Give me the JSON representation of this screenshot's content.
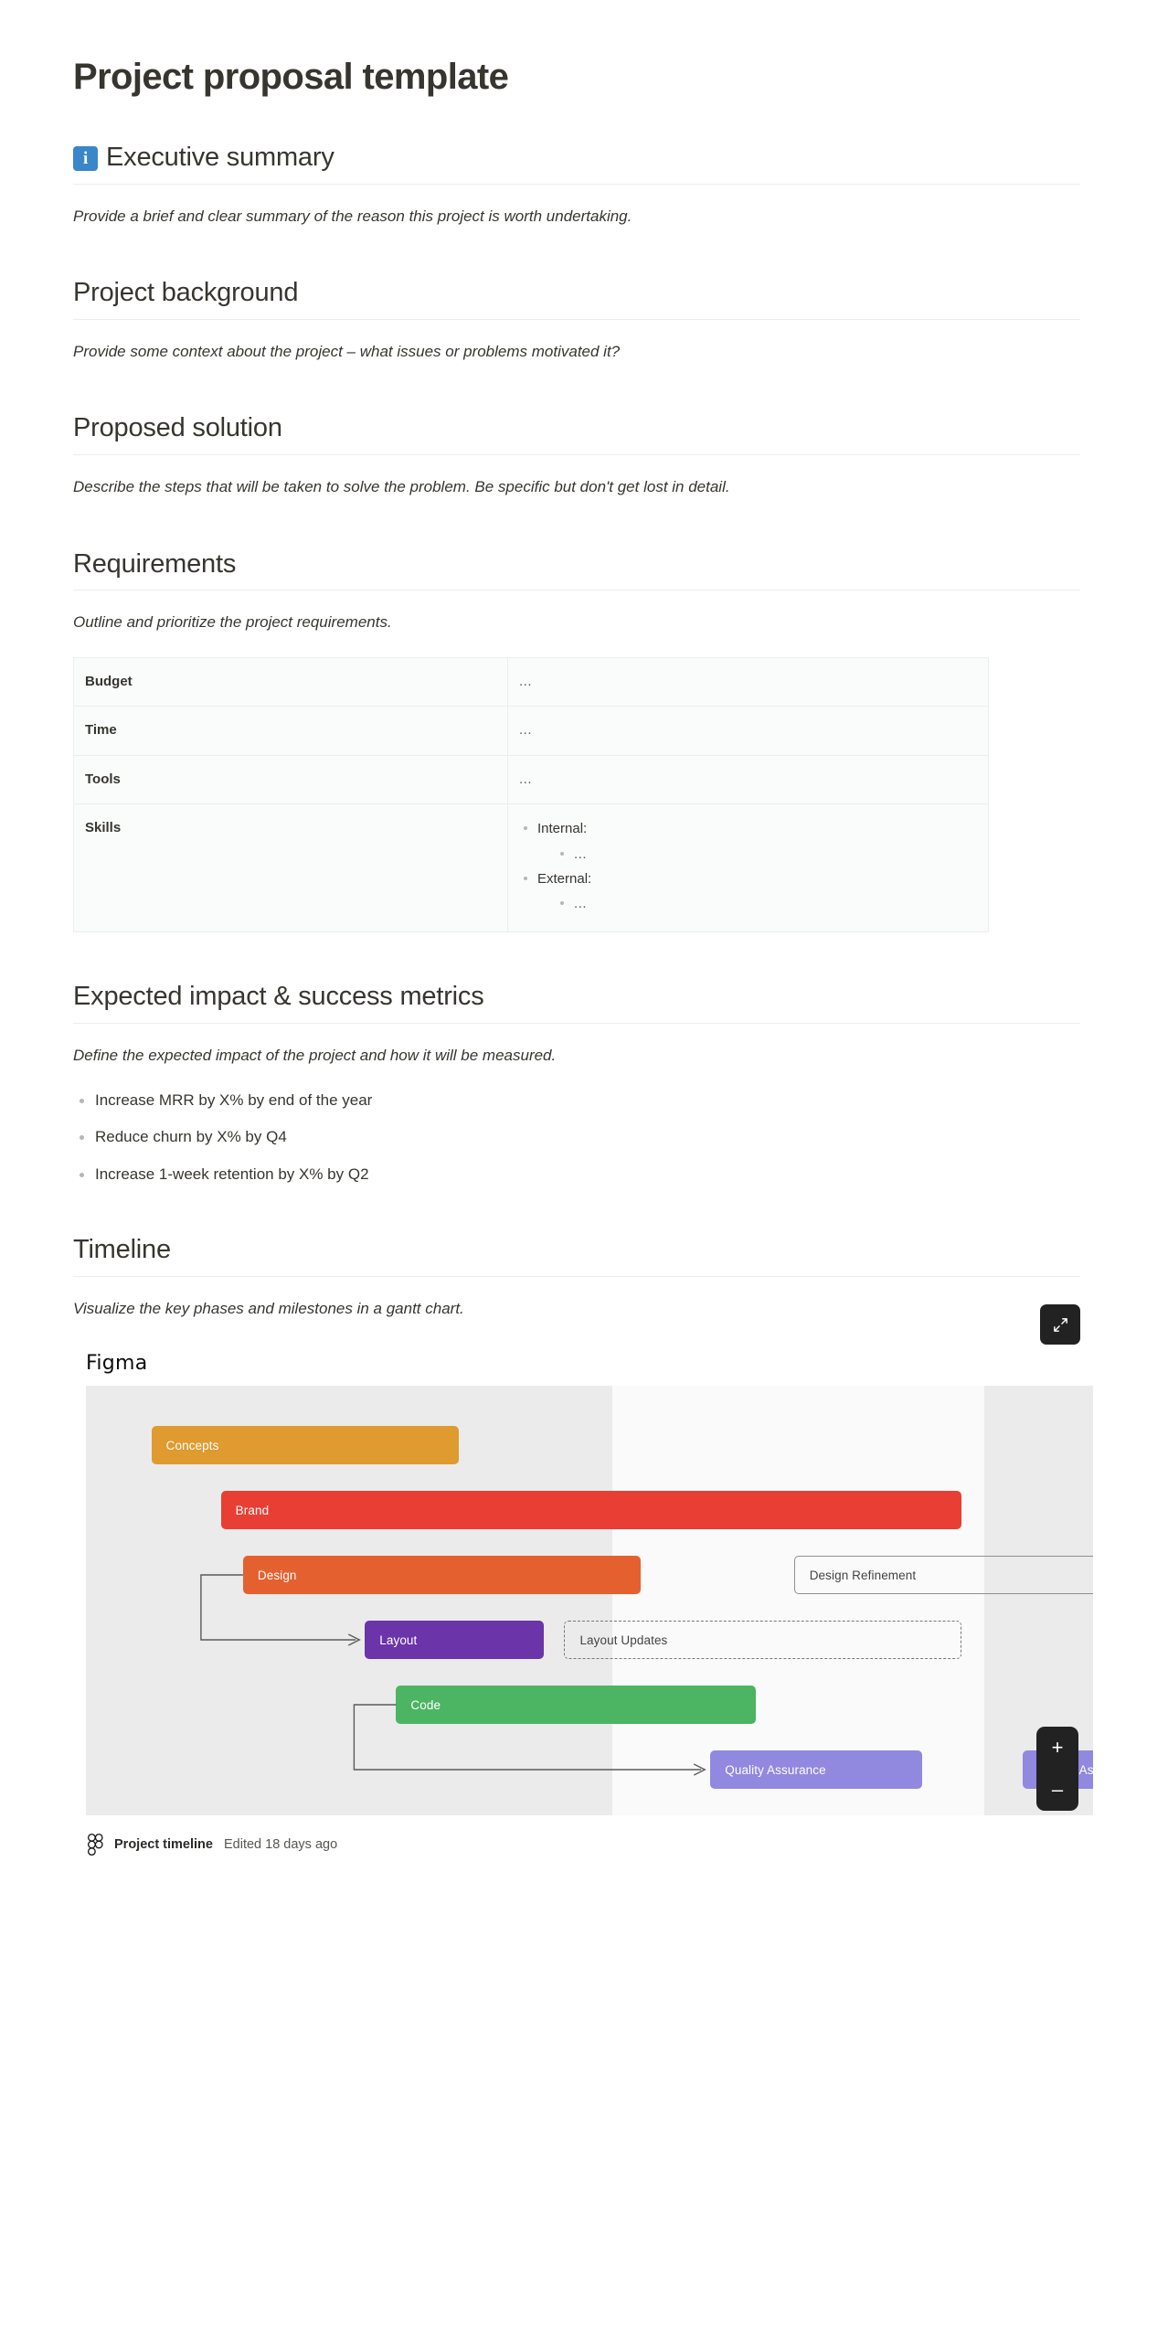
{
  "document": {
    "title": "Project proposal template"
  },
  "sections": {
    "executive_summary": {
      "icon": "info-icon",
      "icon_glyph": "i",
      "heading": "Executive summary",
      "body": "Provide a brief and clear summary of the reason this project is worth undertaking."
    },
    "project_background": {
      "heading": "Project background",
      "body": "Provide some context about the project – what issues or problems motivated it?"
    },
    "proposed_solution": {
      "heading": "Proposed solution",
      "body": "Describe the steps that will be taken to solve the problem. Be specific but don't get lost in detail."
    },
    "requirements": {
      "heading": "Requirements",
      "body": "Outline and prioritize the project requirements.",
      "rows": [
        {
          "key": "Budget",
          "value": "..."
        },
        {
          "key": "Time",
          "value": "..."
        },
        {
          "key": "Tools",
          "value": "..."
        }
      ],
      "skills_row": {
        "key": "Skills",
        "items": [
          {
            "label": "Internal:",
            "sub": "..."
          },
          {
            "label": "External:",
            "sub": "..."
          }
        ]
      }
    },
    "expected_impact": {
      "heading": "Expected impact & success metrics",
      "body": "Define the expected impact of the project and how it will be measured.",
      "bullets": [
        "Increase MRR by X% by end of the year",
        "Reduce churn by X% by Q4",
        "Increase 1-week retention by X% by Q2"
      ]
    },
    "timeline": {
      "heading": "Timeline",
      "body": "Visualize the key phases and milestones in a gantt chart.",
      "embed": {
        "provider": "Figma",
        "expand_label": "Expand",
        "zoom_in_label": "+",
        "zoom_out_label": "–",
        "footer": {
          "file_name": "Project timeline",
          "meta": "Edited 18 days ago"
        }
      }
    }
  },
  "chart_data": {
    "type": "bar",
    "title": "Project timeline",
    "xlabel": "",
    "ylabel": "",
    "orientation": "horizontal",
    "grid": false,
    "legend": "none",
    "bands": [
      {
        "start_pct": 0.0,
        "end_pct": 52.3,
        "color": "#ebebeb"
      },
      {
        "start_pct": 52.3,
        "end_pct": 89.2,
        "color": "#fafafa"
      },
      {
        "start_pct": 89.2,
        "end_pct": 100.0,
        "color": "#ebebeb"
      }
    ],
    "categories": [
      "Concepts",
      "Brand",
      "Design",
      "Design Refinement",
      "Layout",
      "Layout Updates",
      "Code",
      "Quality Assurance",
      "Quality Assurance"
    ],
    "tasks": [
      {
        "label": "Concepts",
        "row": 0,
        "start_pct": 6.5,
        "end_pct": 37.0,
        "color": "#df9a30",
        "style": "solid",
        "text_color": "#ffffff"
      },
      {
        "label": "Brand",
        "row": 1,
        "start_pct": 13.4,
        "end_pct": 86.9,
        "color": "#e83e33",
        "style": "solid",
        "text_color": "#ffffff"
      },
      {
        "label": "Design",
        "row": 2,
        "start_pct": 15.6,
        "end_pct": 55.1,
        "color": "#e5602f",
        "style": "solid",
        "text_color": "#ffffff"
      },
      {
        "label": "Design Refinement",
        "row": 2,
        "start_pct": 70.3,
        "end_pct": 107.9,
        "color": "#8f8f8f",
        "style": "outline",
        "text_color": "#444444"
      },
      {
        "label": "Layout",
        "row": 3,
        "start_pct": 27.7,
        "end_pct": 45.5,
        "color": "#6b34a8",
        "style": "solid",
        "text_color": "#ffffff"
      },
      {
        "label": "Layout Updates",
        "row": 3,
        "start_pct": 47.5,
        "end_pct": 86.9,
        "color": "#777777",
        "style": "dashed",
        "text_color": "#444444"
      },
      {
        "label": "Code",
        "row": 4,
        "start_pct": 30.8,
        "end_pct": 66.5,
        "color": "#4cb563",
        "style": "solid",
        "text_color": "#ffffff"
      },
      {
        "label": "Quality Assurance",
        "row": 5,
        "start_pct": 62.0,
        "end_pct": 83.0,
        "color": "#9188e0",
        "style": "solid",
        "text_color": "#ffffff"
      },
      {
        "label": "Quality Assurance",
        "row": 5,
        "start_pct": 93.0,
        "end_pct": 113.0,
        "color": "#9188e0",
        "style": "solid",
        "text_color": "#ffffff"
      }
    ],
    "dependencies": [
      {
        "from": "Design",
        "to": "Layout"
      },
      {
        "from": "Code",
        "to": "Quality Assurance"
      }
    ],
    "colors": {
      "concepts": "#df9a30",
      "brand": "#e83e33",
      "design": "#e5602f",
      "layout": "#6b34a8",
      "code": "#4cb563",
      "quality_assurance": "#9188e0",
      "band_shaded": "#ebebeb",
      "band_light": "#fafafa"
    }
  }
}
